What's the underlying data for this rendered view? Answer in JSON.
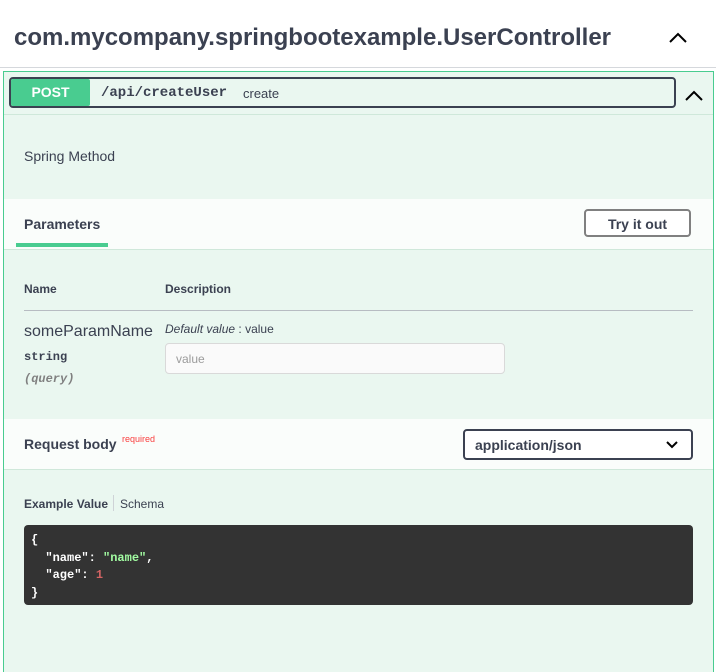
{
  "tag": {
    "title": "com.mycompany.springbootexample.UserController"
  },
  "operation": {
    "method": "POST",
    "path": "/api/createUser",
    "summary": "create",
    "description": "Spring Method"
  },
  "parameters": {
    "tab_label": "Parameters",
    "try_button": "Try it out",
    "col_name": "Name",
    "col_description": "Description",
    "items": [
      {
        "name": "someParamName",
        "type": "string",
        "in": "(query)",
        "default_label": "Default value",
        "default_sep": " : ",
        "default_value": "value",
        "placeholder": "value"
      }
    ]
  },
  "request_body": {
    "label": "Request body",
    "required": "required",
    "content_type": "application/json",
    "example_tab": "Example Value",
    "schema_tab": "Schema",
    "example": {
      "open": "{",
      "key1": "\"name\"",
      "val1": "\"name\"",
      "key2": "\"age\"",
      "val2": "1",
      "close": "}"
    }
  },
  "colors": {
    "post": "#49cc90",
    "post_bg": "#eaf7f0",
    "text": "#3b4151",
    "required": "#f93e3e",
    "code_bg": "#333333"
  },
  "icons": {
    "collapse": "chevron-up-icon",
    "dropdown": "chevron-down-icon"
  }
}
